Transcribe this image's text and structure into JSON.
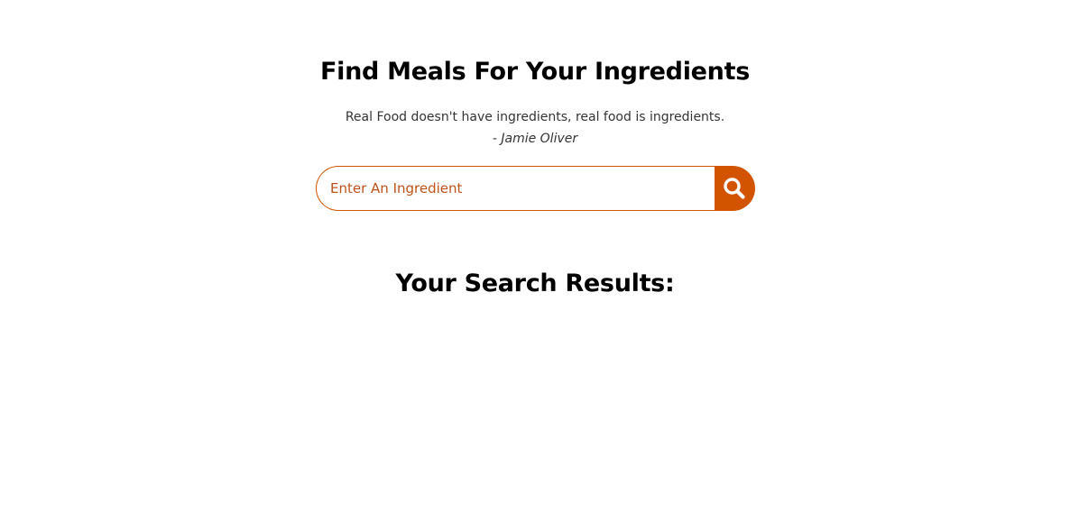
{
  "header": {
    "title": "Find Meals For Your Ingredients",
    "quote": "Real Food doesn't have ingredients, real food is ingredients.",
    "quote_author": "- Jamie Oliver"
  },
  "search": {
    "placeholder": "Enter An Ingredient",
    "value": "",
    "button_icon": "search-icon"
  },
  "results": {
    "heading": "Your Search Results:",
    "items": []
  },
  "colors": {
    "accent": "#d35400",
    "text": "#000000",
    "muted_text": "#333333",
    "background": "#ffffff"
  }
}
